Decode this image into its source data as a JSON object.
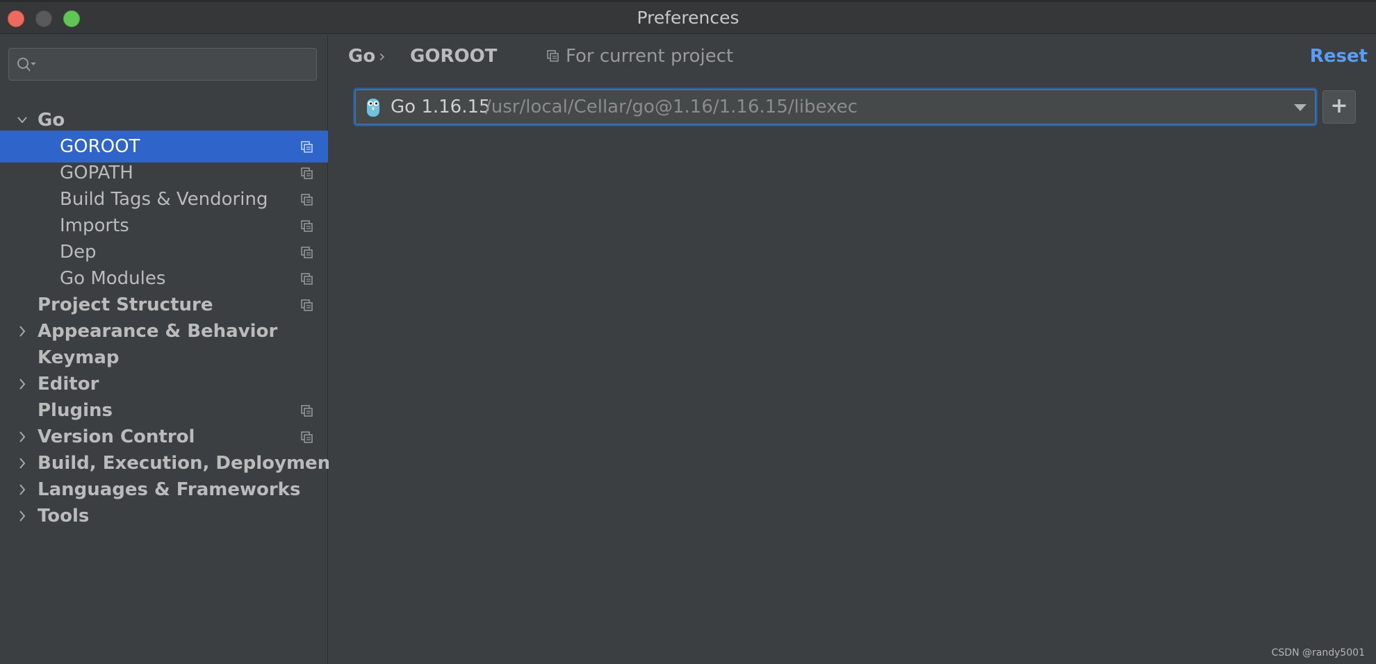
{
  "window": {
    "title": "Preferences"
  },
  "sidebar": {
    "search": {
      "value": "",
      "placeholder": ""
    },
    "items": [
      {
        "label": "Go",
        "expanded": true,
        "bold": true,
        "project_scoped": false
      },
      {
        "label": "GOROOT",
        "selected": true,
        "project_scoped": true
      },
      {
        "label": "GOPATH",
        "project_scoped": true
      },
      {
        "label": "Build Tags & Vendoring",
        "project_scoped": true
      },
      {
        "label": "Imports",
        "project_scoped": true
      },
      {
        "label": "Dep",
        "project_scoped": true
      },
      {
        "label": "Go Modules",
        "project_scoped": true
      },
      {
        "label": "Project Structure",
        "bold": true,
        "project_scoped": true
      },
      {
        "label": "Appearance & Behavior",
        "bold": true,
        "expandable": true
      },
      {
        "label": "Keymap",
        "bold": true
      },
      {
        "label": "Editor",
        "bold": true,
        "expandable": true
      },
      {
        "label": "Plugins",
        "bold": true,
        "project_scoped": true
      },
      {
        "label": "Version Control",
        "bold": true,
        "expandable": true,
        "project_scoped": true
      },
      {
        "label": "Build, Execution, Deployment",
        "bold": true,
        "expandable": true
      },
      {
        "label": "Languages & Frameworks",
        "bold": true,
        "expandable": true
      },
      {
        "label": "Tools",
        "bold": true,
        "expandable": true
      }
    ]
  },
  "main": {
    "breadcrumb": {
      "parent": "Go",
      "separator": "›",
      "current": "GOROOT"
    },
    "scope_label": "For current project",
    "reset_label": "Reset",
    "sdk": {
      "name": "Go 1.16.15",
      "path": "/usr/local/Cellar/go@1.16/1.16.15/libexec"
    },
    "add_label": "+"
  },
  "watermark": "CSDN @randy5001",
  "colors": {
    "selection": "#2f65ca",
    "link": "#589df6",
    "background": "#3c3f41"
  }
}
